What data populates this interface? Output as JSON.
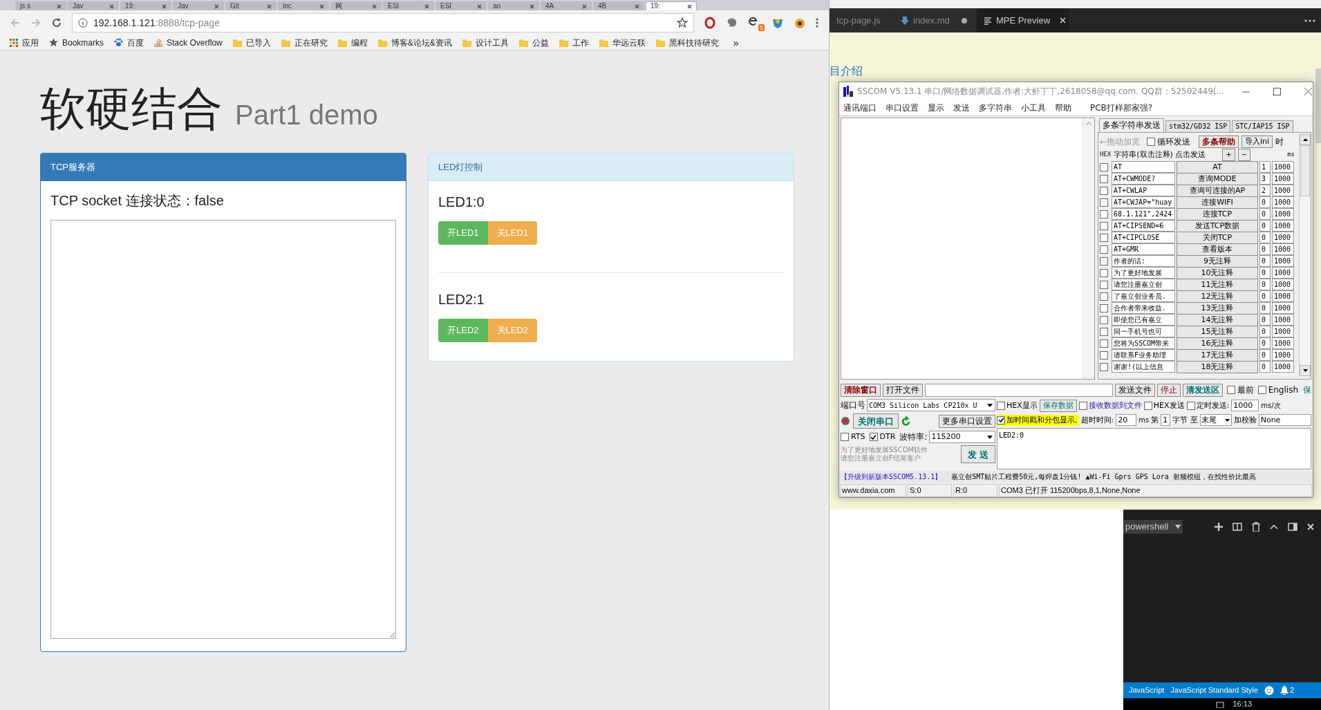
{
  "browser": {
    "tabs": [
      {
        "label": "js s",
        "selected": false
      },
      {
        "label": "Jav",
        "selected": false
      },
      {
        "label": "19:",
        "selected": false
      },
      {
        "label": "Jav",
        "selected": false
      },
      {
        "label": "Git",
        "selected": false
      },
      {
        "label": "inc",
        "selected": false
      },
      {
        "label": "网",
        "selected": false
      },
      {
        "label": "ESI",
        "selected": false
      },
      {
        "label": "ESI",
        "selected": false
      },
      {
        "label": "ao",
        "selected": false
      },
      {
        "label": "4A",
        "selected": false
      },
      {
        "label": "4B",
        "selected": false
      },
      {
        "label": "19:",
        "selected": true
      }
    ],
    "address": {
      "host": "192.168.1.121",
      "path": ":8888/tcp-page"
    },
    "extension_badge": "5",
    "bookmarks": [
      {
        "kind": "apps",
        "label": "应用"
      },
      {
        "kind": "star",
        "label": "Bookmarks"
      },
      {
        "kind": "paw",
        "label": "百度"
      },
      {
        "kind": "stack",
        "label": "Stack Overflow"
      },
      {
        "kind": "folder",
        "label": "已导入"
      },
      {
        "kind": "folder",
        "label": "正在研究"
      },
      {
        "kind": "folder",
        "label": "编程"
      },
      {
        "kind": "folder",
        "label": "博客&论坛&资讯"
      },
      {
        "kind": "folder",
        "label": "设计工具"
      },
      {
        "kind": "folder",
        "label": "公益"
      },
      {
        "kind": "folder",
        "label": "工作"
      },
      {
        "kind": "folder",
        "label": "华远云联"
      },
      {
        "kind": "folder",
        "label": "黑科技待研究"
      }
    ],
    "more": "»"
  },
  "page": {
    "title": "软硬结合",
    "subtitle": "Part1 demo",
    "tcp_panel": {
      "title": "TCP服务器",
      "status": "TCP socket 连接状态：false"
    },
    "led_panel": {
      "title": "LED灯控制",
      "leds": [
        {
          "label": "LED1:0",
          "on_button": "开LED1",
          "off_button": "关LED1"
        },
        {
          "label": "LED2:1",
          "on_button": "开LED2",
          "off_button": "关LED2"
        }
      ]
    }
  },
  "editor": {
    "tabs": [
      {
        "kind": "js",
        "label": "tcp-page.js",
        "selected": false,
        "dirty": false
      },
      {
        "kind": "markdown",
        "label": "index.md",
        "selected": false,
        "dirty": true
      },
      {
        "kind": "preview",
        "label": "MPE Preview",
        "selected": true,
        "dirty": false
      }
    ],
    "preview_text": "目介绍",
    "terminal": {
      "shell": "powershell"
    },
    "status_bar": {
      "language": "JavaScript",
      "linter": "JavaScript Standard Style",
      "notifications": "2"
    },
    "clock": "16:13"
  },
  "sscom": {
    "title": "SSCOM V5.13.1 串口/网络数据调试器,作者:大虾丁丁,2618058@qq.com. QQ群：52502449(...",
    "menu": [
      "通讯端口",
      "串口设置",
      "显示",
      "发送",
      "多字符串",
      "小工具",
      "帮助",
      "PCB打样那家强?"
    ],
    "tabs": [
      {
        "label": "多条字符串发送",
        "selected": true
      },
      {
        "label": "stm32/GD32 ISP",
        "selected": false
      },
      {
        "label": "STC/IAP15 ISP",
        "selected": false
      }
    ],
    "multi": {
      "drag_hint": "←拖动加宽",
      "loop_send": {
        "label": "循环发送",
        "checked": false
      },
      "help_button": "多条帮助",
      "import_button": "导入ini",
      "time_label": "时",
      "hex_label": "HEX",
      "column_label": "字符串(双击注释) 点击发送",
      "add": "+",
      "remove": "−",
      "ms_label": "ms",
      "rows": [
        {
          "checked": false,
          "text": "AT",
          "button": "AT",
          "order": "1",
          "delay": "1000"
        },
        {
          "checked": false,
          "text": "AT+CWMODE?",
          "button": "查询MODE",
          "order": "3",
          "delay": "1000"
        },
        {
          "checked": false,
          "text": "AT+CWLAP",
          "button": "查询可连接的AP",
          "order": "2",
          "delay": "1000"
        },
        {
          "checked": false,
          "text": "AT+CWJAP=\"huay",
          "button": "连接WIFI",
          "order": "0",
          "delay": "1000"
        },
        {
          "checked": false,
          "text": "68.1.121\",2424",
          "button": "连接TCP",
          "order": "0",
          "delay": "1000"
        },
        {
          "checked": false,
          "text": "AT+CIPSEND=6",
          "button": "发送TCP数据",
          "order": "0",
          "delay": "1000"
        },
        {
          "checked": false,
          "text": "AT+CIPCLOSE",
          "button": "关闭TCP",
          "order": "0",
          "delay": "1000"
        },
        {
          "checked": false,
          "text": "AT+GMR",
          "button": "查看版本",
          "order": "0",
          "delay": "1000"
        },
        {
          "checked": false,
          "text": "作者的话:",
          "button": "9无注释",
          "order": "0",
          "delay": "1000"
        },
        {
          "checked": false,
          "text": "为了更好地发展",
          "button": "10无注释",
          "order": "0",
          "delay": "1000"
        },
        {
          "checked": false,
          "text": "请您注册嘉立创",
          "button": "11无注释",
          "order": "0",
          "delay": "1000"
        },
        {
          "checked": false,
          "text": "了嘉立创业务员.",
          "button": "12无注释",
          "order": "0",
          "delay": "1000"
        },
        {
          "checked": false,
          "text": "合作者带来收益.",
          "button": "13无注释",
          "order": "0",
          "delay": "1000"
        },
        {
          "checked": false,
          "text": "即使您已有嘉立",
          "button": "14无注释",
          "order": "0",
          "delay": "1000"
        },
        {
          "checked": false,
          "text": "同一手机号也可",
          "button": "15无注释",
          "order": "0",
          "delay": "1000"
        },
        {
          "checked": false,
          "text": "您将为SSCOM带来",
          "button": "16无注释",
          "order": "0",
          "delay": "1000"
        },
        {
          "checked": false,
          "text": "请联系F业务助理",
          "button": "17无注释",
          "order": "0",
          "delay": "1000"
        },
        {
          "checked": false,
          "text": "谢谢!(以上信息",
          "button": "18无注释",
          "order": "0",
          "delay": "1000"
        }
      ]
    },
    "toolbar": {
      "clear": "清除窗口",
      "open_file": "打开文件",
      "send_file": "发送文件",
      "stop": "停止",
      "clear_send": "清发送区",
      "topmost": {
        "label": "最前",
        "checked": false
      },
      "english": {
        "label": "English",
        "checked": false
      },
      "save": "保"
    },
    "port": {
      "label": "端口号",
      "value": "COM3 Silicon Labs CP210x U",
      "close_button": "关闭串口",
      "more_settings": "更多串口设置",
      "rts": {
        "label": "RTS",
        "checked": false
      },
      "dtr": {
        "label": "DTR",
        "checked": true
      },
      "baud_label": "波特率:",
      "baud": "115200",
      "promo": [
        "为了更好地发展SSCOM软件",
        "请您注册嘉立创F结尾客户"
      ],
      "send_button": "发 送"
    },
    "options": {
      "hex_display": {
        "label": "HEX显示",
        "checked": false
      },
      "save_data": "保存数据",
      "receive_to_file": {
        "label": "接收数据到文件",
        "checked": false
      },
      "hex_send": {
        "label": "HEX发送",
        "checked": false
      },
      "timed_send": {
        "label": "定时发送:",
        "checked": false
      },
      "interval": "1000",
      "interval_unit": "ms/次",
      "timestamp": {
        "label": "加时间戳和分包显示,",
        "checked": true
      },
      "timeout_label": "超时时间:",
      "timeout": "20",
      "timeout_unit": "ms",
      "from_label": "第",
      "from": "1",
      "to_label": "字节 至",
      "to": "末尾",
      "checksum_label": "加校验",
      "checksum": "None"
    },
    "send_text": "LED2:0",
    "marquee": {
      "link": "【升级到新版本SSCOM5.13.1】",
      "ad": "嘉立创SMT贴片工程费50元,每焊盘1分钱! ▲Wi-Fi Gprs GPS Lora 射频模组，在找性价比最高"
    },
    "status": [
      "www.daxia.com",
      "S:0",
      "R:0",
      "COM3 已打开  115200bps,8,1,None,None"
    ]
  }
}
